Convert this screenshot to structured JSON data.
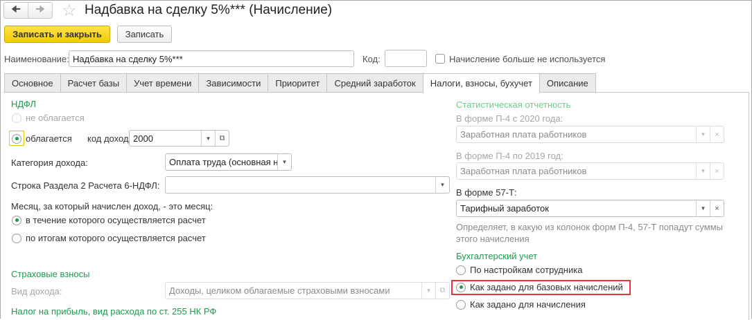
{
  "window": {
    "title": "Надбавка на сделку 5%*** (Начисление)"
  },
  "toolbar": {
    "save_close": "Записать и закрыть",
    "save": "Записать"
  },
  "header": {
    "name_label": "Наименование:",
    "name_value": "Надбавка на сделку 5%***",
    "code_label": "Код:",
    "code_value": "",
    "unused_label": "Начисление больше не используется"
  },
  "tabs": [
    "Основное",
    "Расчет базы",
    "Учет времени",
    "Зависимости",
    "Приоритет",
    "Средний заработок",
    "Налоги, взносы, бухучет",
    "Описание"
  ],
  "ndfl": {
    "title": "НДФЛ",
    "not_taxed": "не облагается",
    "taxed": "облагается",
    "code_label": "код дохода:",
    "code_value": "2000",
    "category_label": "Категория дохода:",
    "category_value": "Оплата труда (основная н",
    "line_label": "Строка Раздела 2 Расчета 6-НДФЛ:",
    "line_value": "",
    "month_label": "Месяц, за который начислен доход, - это месяц:",
    "month_opt1": "в течение которого осуществляется расчет",
    "month_opt2": "по итогам которого осуществляется расчет"
  },
  "insurance": {
    "title": "Страховые взносы",
    "kind_label": "Вид дохода:",
    "kind_value": "Доходы, целиком облагаемые страховыми взносами"
  },
  "profit_tax": {
    "title": "Налог на прибыль, вид расхода по ст. 255 НК РФ"
  },
  "stats": {
    "title": "Статистическая отчетность",
    "p4_2020_label": "В форме П-4 с 2020 года:",
    "p4_2020_value": "Заработная плата работников",
    "p4_2019_label": "В форме П-4 по 2019 год:",
    "p4_2019_value": "Заработная плата работников",
    "f57_label": "В форме 57-Т:",
    "f57_value": "Тарифный заработок",
    "hint": "Определяет, в какую из колонок форм П-4, 57-Т попадут суммы",
    "hint2": "этого начисления"
  },
  "accounting": {
    "title": "Бухгалтерский учет",
    "opt1": "По настройкам сотрудника",
    "opt2": "Как задано для базовых начислений",
    "opt3": "Как задано для начисления"
  },
  "colors": {
    "accent": "#f2cb00",
    "section": "#1c9a4e",
    "highlight": "#e8343a"
  }
}
